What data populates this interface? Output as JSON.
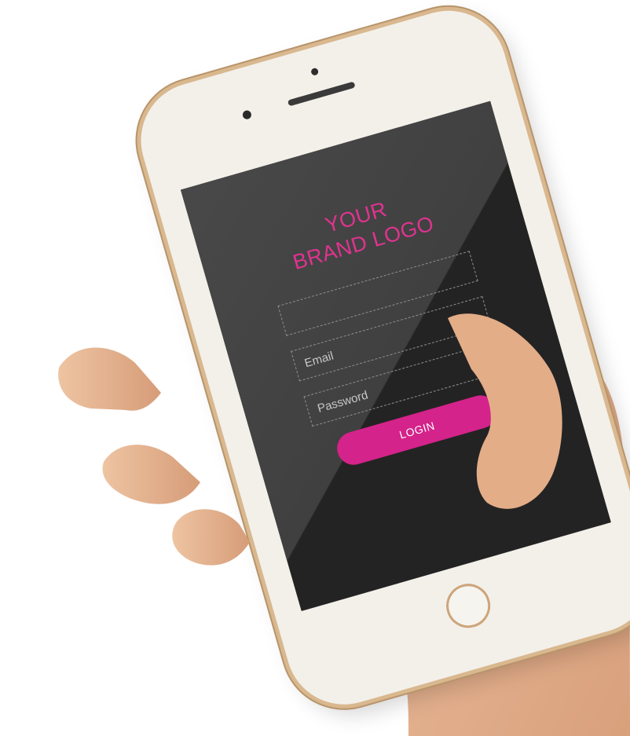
{
  "brand": {
    "logo_text": "YOUR\nBRAND LOGO",
    "color": "#e0338f"
  },
  "form": {
    "email_placeholder": "Email",
    "password_placeholder": "Password",
    "login_label": "LOGIN"
  },
  "colors": {
    "screen_background": "#232323",
    "button_accent": "#d4238a",
    "phone_frame": "#f3f0ea",
    "phone_trim": "#d9b88f",
    "skin": "#e7b896"
  }
}
